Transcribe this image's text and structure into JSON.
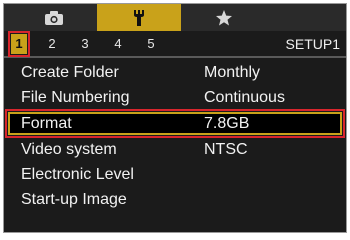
{
  "tabs": [
    {
      "icon": "camera-icon",
      "active": false
    },
    {
      "icon": "wrench-icon",
      "active": true
    },
    {
      "icon": "star-icon",
      "active": false
    }
  ],
  "pages": [
    "1",
    "2",
    "3",
    "4",
    "5"
  ],
  "active_page": "1",
  "page_title": "SETUP1",
  "menu": [
    {
      "label": "Create Folder",
      "value": "Monthly"
    },
    {
      "label": "File Numbering",
      "value": "Continuous"
    },
    {
      "label": "Format",
      "value": "7.8GB"
    },
    {
      "label": "Video system",
      "value": "NTSC"
    },
    {
      "label": "Electronic Level",
      "value": ""
    },
    {
      "label": "Start-up Image",
      "value": ""
    }
  ],
  "selected_item": "Format",
  "colors": {
    "accent": "#c9a21a",
    "highlight": "#d9262d",
    "background": "#1b1b1b"
  }
}
